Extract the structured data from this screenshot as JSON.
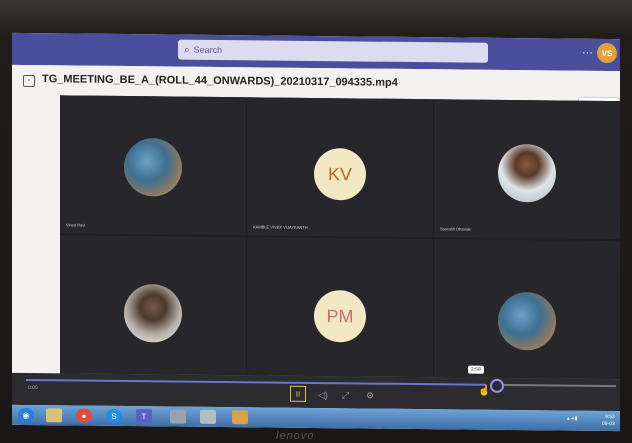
{
  "topbar": {
    "search_placeholder": "Search",
    "more_label": "···",
    "user_initials": "VS"
  },
  "file": {
    "title": "TG_MEETING_BE_A_(ROLL_44_ONWARDS)_20210317_094335.mp4",
    "close_label": "Close"
  },
  "participants": [
    {
      "name": "Vinod Ravi",
      "display": "photo",
      "icon": "photo-avatar"
    },
    {
      "name": "KAMBLE VIVEK VIJAYKANTH",
      "display": "initials",
      "initials": "KV"
    },
    {
      "name": "Saurabh Dhavale",
      "display": "photo",
      "icon": "photo-avatar"
    },
    {
      "name": "",
      "display": "photo",
      "icon": "photo-avatar"
    },
    {
      "name": "",
      "display": "initials",
      "initials": "PM"
    },
    {
      "name": "",
      "display": "photo",
      "icon": "photo-avatar"
    }
  ],
  "player": {
    "elapsed": "0:05",
    "hover_time": "2:58",
    "progress_fraction": 0.78,
    "buttons": [
      "pause-icon",
      "volume-icon",
      "fullscreen-icon",
      "settings-icon"
    ],
    "glyphs": {
      "pause": "II",
      "volume": "◁)",
      "fullscreen": "⤢",
      "settings": "⚙"
    }
  },
  "taskbar": {
    "icons": [
      "windows-start-icon",
      "explorer-icon",
      "chrome-icon",
      "skype-icon",
      "teams-icon",
      "app-icon",
      "app-icon-2",
      "folder-icon"
    ],
    "time": "9:52",
    "date": "09-03"
  },
  "bezel": {
    "brand": "lenovo"
  },
  "colors": {
    "teams_purple": "#4b4e9c",
    "progress": "#6f73c9",
    "initials_bg": "#f3e8c4"
  }
}
